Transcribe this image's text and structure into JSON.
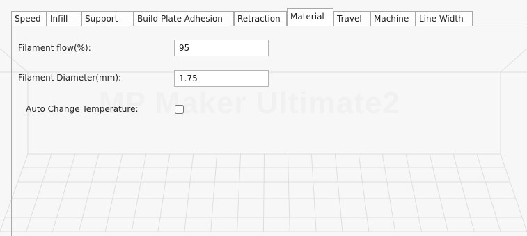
{
  "watermark": "MP Maker Ultimate2",
  "tabs": [
    {
      "label": "Speed",
      "active": false
    },
    {
      "label": "Infill",
      "active": false
    },
    {
      "label": "Support",
      "active": false
    },
    {
      "label": "Build Plate Adhesion",
      "active": false
    },
    {
      "label": "Retraction",
      "active": false
    },
    {
      "label": "Material",
      "active": true
    },
    {
      "label": "Travel",
      "active": false
    },
    {
      "label": "Machine",
      "active": false
    },
    {
      "label": "Line Width",
      "active": false
    }
  ],
  "material": {
    "filament_flow": {
      "label": "Filament flow(%):",
      "value": "95"
    },
    "filament_diameter": {
      "label": "Filament Diameter(mm):",
      "value": "1.75"
    },
    "auto_change_temperature": {
      "label": "Auto Change Temperature:",
      "checked": false
    }
  }
}
